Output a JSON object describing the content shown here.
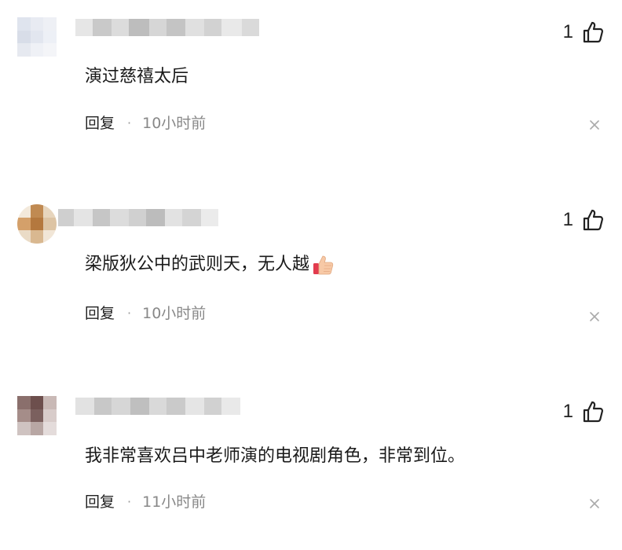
{
  "colors": {
    "text": "#1a1a1a",
    "meta_text": "#888888",
    "icon": "#222222",
    "close_icon": "#aaaaaa"
  },
  "comments": [
    {
      "text": "演过慈禧太后",
      "likes": "1",
      "reply_label": "回复",
      "separator": "·",
      "time": "10小时前",
      "emoji": null
    },
    {
      "text": "梁版狄公中的武则天，无人越",
      "likes": "1",
      "reply_label": "回复",
      "separator": "·",
      "time": "10小时前",
      "emoji": "thumbs-up-emoji"
    },
    {
      "text": "我非常喜欢吕中老师演的电视剧角色，非常到位。",
      "likes": "1",
      "reply_label": "回复",
      "separator": "·",
      "time": "11小时前",
      "emoji": null
    }
  ]
}
